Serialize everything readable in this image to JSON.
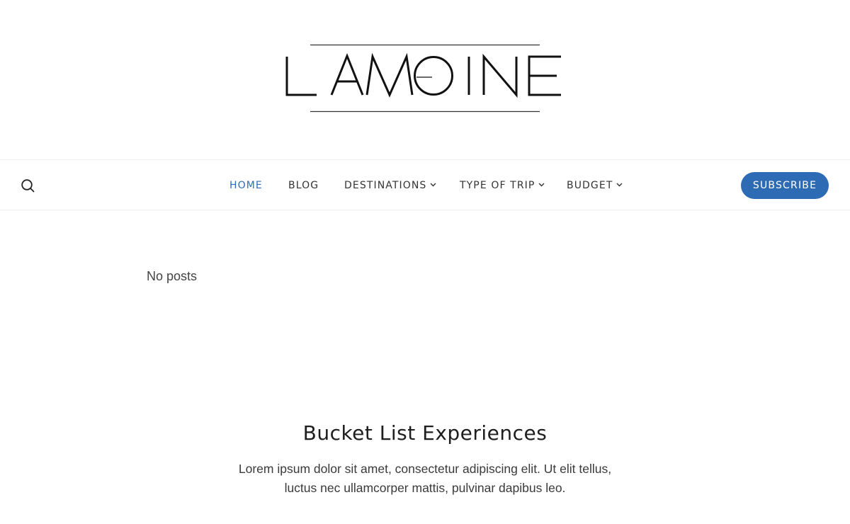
{
  "logo": {
    "text": "LAMOINE"
  },
  "nav": {
    "search_icon": "search-icon",
    "items": [
      {
        "label": "HOME",
        "active": true,
        "has_dropdown": false
      },
      {
        "label": "BLOG",
        "active": false,
        "has_dropdown": false
      },
      {
        "label": "DESTINATIONS",
        "active": false,
        "has_dropdown": true
      },
      {
        "label": "TYPE OF TRIP",
        "active": false,
        "has_dropdown": true
      },
      {
        "label": "BUDGET",
        "active": false,
        "has_dropdown": true
      }
    ],
    "dropdown_icon": "chevron-down-icon",
    "subscribe_label": "SUBSCRIBE"
  },
  "main": {
    "empty_message": "No posts",
    "section": {
      "title": "Bucket List Experiences",
      "text": "Lorem ipsum dolor sit amet, consectetur adipiscing elit. Ut elit tellus, luctus nec ullamcorper mattis, pulvinar dapibus leo."
    }
  },
  "colors": {
    "accent": "#2d6cb5",
    "text": "#333333",
    "background": "#ffffff",
    "divider": "#eeeeee"
  }
}
